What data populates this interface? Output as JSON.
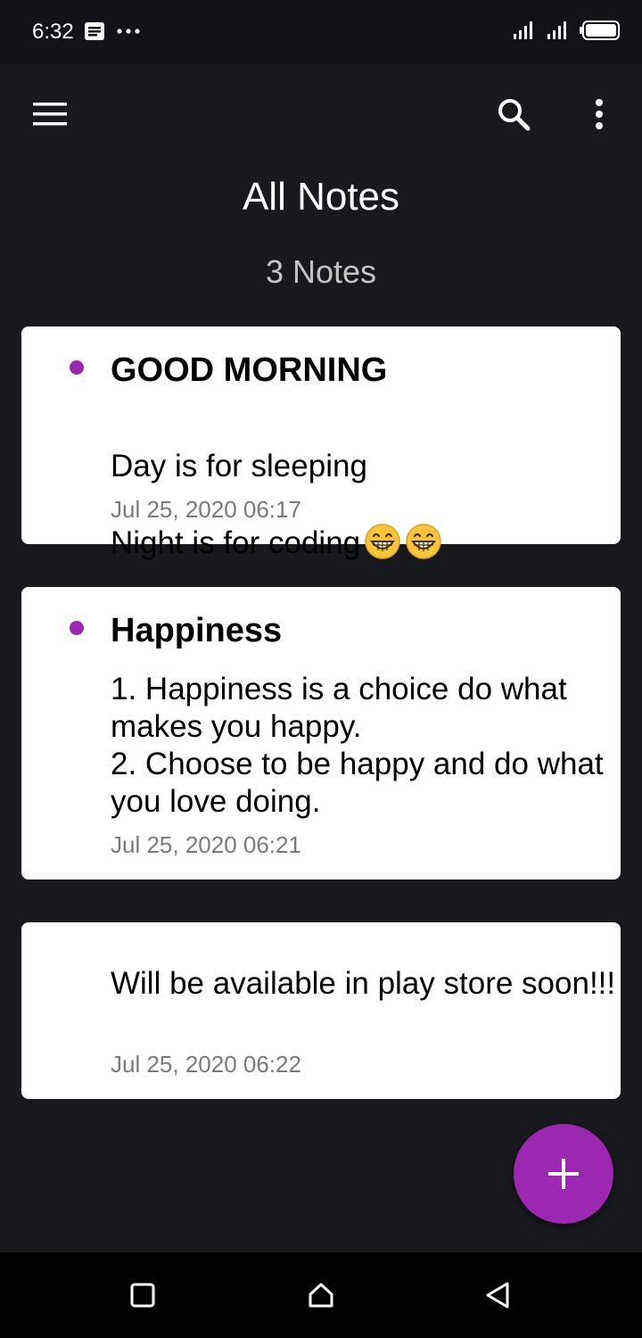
{
  "status_bar": {
    "time": "6:32"
  },
  "app_bar": {
    "menu_icon": "hamburger-menu-icon",
    "search_icon": "search-icon",
    "more_icon": "more-vertical-icon"
  },
  "page": {
    "title": "All Notes",
    "count": "3 Notes"
  },
  "notes": [
    {
      "title": "GOOD MORNING",
      "body_line1": "Day is for sleeping",
      "body_line2": "Night is for coding",
      "emoji": "grinning-face-emoji",
      "date": "Jul 25, 2020 06:17",
      "has_dot": true
    },
    {
      "title": "Happiness",
      "body": "1. Happiness is a choice do what makes you happy.\n2. Choose to be happy and do what you love doing.",
      "date": "Jul 25, 2020 06:21",
      "has_dot": true
    },
    {
      "title": "",
      "body": "Will be available in play store soon!!!",
      "date": "Jul 25, 2020 06:22",
      "has_dot": false
    }
  ],
  "fab": {
    "icon": "add-icon"
  },
  "nav_bar": {
    "recents_icon": "square-recents-icon",
    "home_icon": "home-icon",
    "back_icon": "triangle-back-icon"
  },
  "colors": {
    "background": "#18191d",
    "accent": "#9c27b0",
    "card": "#ffffff",
    "date_text": "#7a7a7a"
  }
}
